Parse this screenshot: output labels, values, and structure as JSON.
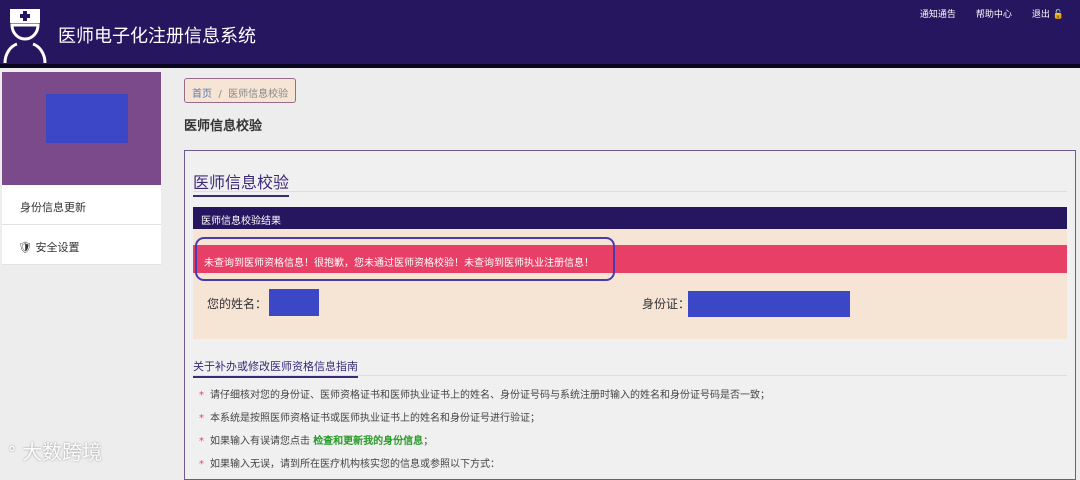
{
  "header": {
    "title": "医师电子化注册信息系统",
    "links": [
      "通知通告",
      "帮助中心",
      "退出"
    ]
  },
  "sidebar": {
    "items": [
      "身份信息更新",
      "安全设置"
    ]
  },
  "breadcrumb": {
    "home": "首页",
    "sep": "/",
    "current": "医师信息校验"
  },
  "page_title": "医师信息校验",
  "panel": {
    "heading": "医师信息校验",
    "result_title": "医师信息校验结果",
    "alert": "未查询到医师资格信息！很抱歉，您未通过医师资格校验！未查询到医师执业注册信息！",
    "name_label": "您的姓名：",
    "id_label": "身份证："
  },
  "guide": {
    "heading": "关于补办或修改医师资格信息指南",
    "items": [
      "请仔细核对您的身份证、医师资格证书和医师执业证书上的姓名、身份证号码与系统注册时输入的姓名和身份证号码是否一致；",
      "本系统是按照医师资格证书或医师执业证书上的姓名和身份证号进行验证；",
      "如果输入有误请您点击",
      "如果输入无误，请到所在医疗机构核实您的信息或参照以下方式："
    ],
    "link": "检查和更新我的身份信息",
    "link_suffix": "；"
  },
  "watermark": "大数跨境"
}
